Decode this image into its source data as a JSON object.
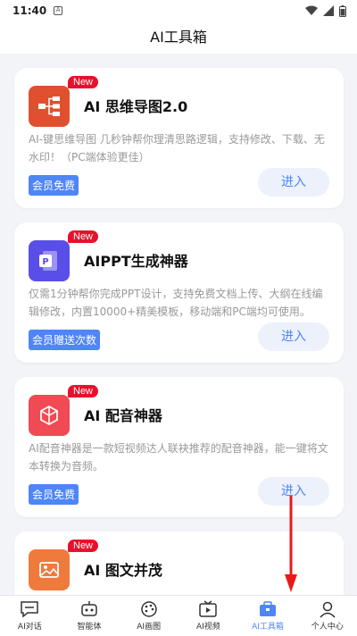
{
  "status": {
    "time": "11:40"
  },
  "header": {
    "title": "AI工具箱"
  },
  "cards": [
    {
      "badge": "New",
      "title": "AI 思维导图2.0",
      "desc": "AI-键思维导图 几秒钟帮你理清思路逻辑，支持修改、下载、无水印！（PC端体验更佳）",
      "tag": "会员免费",
      "button": "进入",
      "icon": "mindmap-icon",
      "color": "#e0502f"
    },
    {
      "badge": "New",
      "title": "AIPPT生成神器",
      "desc": "仅需1分钟帮你完成PPT设计，支持免费文档上传、大纲在线编辑修改，内置10000+精美模板，移动端和PC端均可使用。",
      "tag": "会员赠送次数",
      "button": "进入",
      "icon": "ppt-icon",
      "color": "#5a4ee8"
    },
    {
      "badge": "New",
      "title": "AI 配音神器",
      "desc": "AI配音神器是一款短视频达人联袂推荐的配音神器，能一键将文本转换为音频。",
      "tag": "会员免费",
      "button": "进入",
      "icon": "dubbing-icon",
      "color": "#f04a54"
    },
    {
      "badge": "New",
      "title": "AI 图文并茂",
      "desc": "",
      "icon": "image-text-icon",
      "color": "#f07a3c"
    }
  ],
  "tabs": [
    {
      "label": "AI对话",
      "icon": "chat-icon"
    },
    {
      "label": "智能体",
      "icon": "robot-icon"
    },
    {
      "label": "AI画图",
      "icon": "palette-icon"
    },
    {
      "label": "AI视频",
      "icon": "video-icon"
    },
    {
      "label": "AI工具箱",
      "icon": "toolbox-icon",
      "active": true
    },
    {
      "label": "个人中心",
      "icon": "profile-icon"
    }
  ]
}
